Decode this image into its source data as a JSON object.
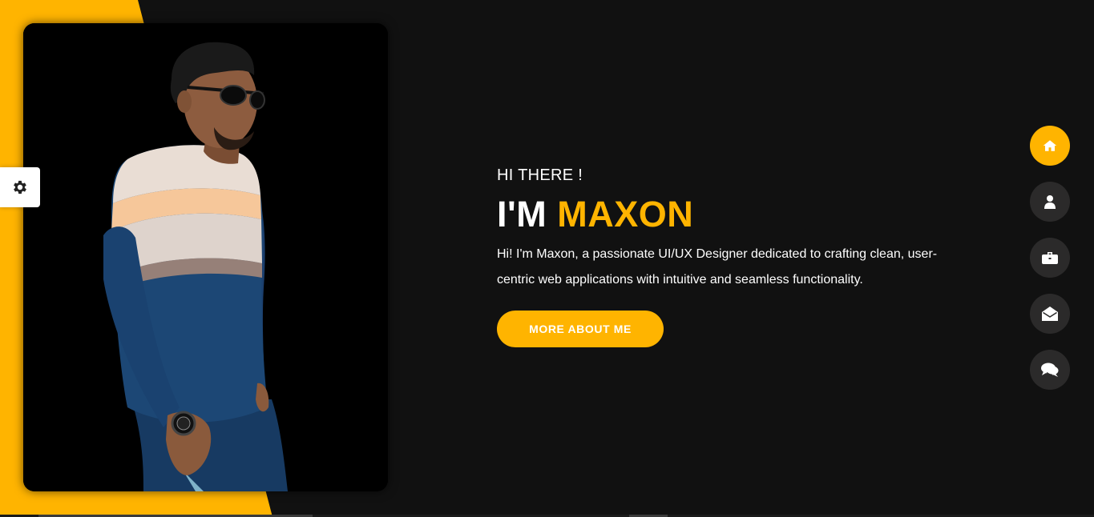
{
  "theme": {
    "accent": "#ffb400",
    "background": "#111111",
    "nav_inactive": "#2b2a2a"
  },
  "settings": {
    "icon": "gear-icon"
  },
  "hero": {
    "greeting": "HI THERE !",
    "heading_prefix": "I'M",
    "heading_name": "MAXON",
    "bio": "Hi! I'm Maxon, a passionate UI/UX Designer dedicated to crafting clean, user-centric web applications with intuitive and seamless functionality.",
    "cta_label": "MORE ABOUT ME"
  },
  "photo": {
    "subject": "portrait"
  },
  "nav": {
    "items": [
      {
        "id": "home",
        "icon": "home-icon",
        "active": true
      },
      {
        "id": "about",
        "icon": "user-icon",
        "active": false
      },
      {
        "id": "portfolio",
        "icon": "briefcase-icon",
        "active": false
      },
      {
        "id": "contact",
        "icon": "envelope-open-icon",
        "active": false
      },
      {
        "id": "blog",
        "icon": "comments-icon",
        "active": false
      }
    ]
  }
}
